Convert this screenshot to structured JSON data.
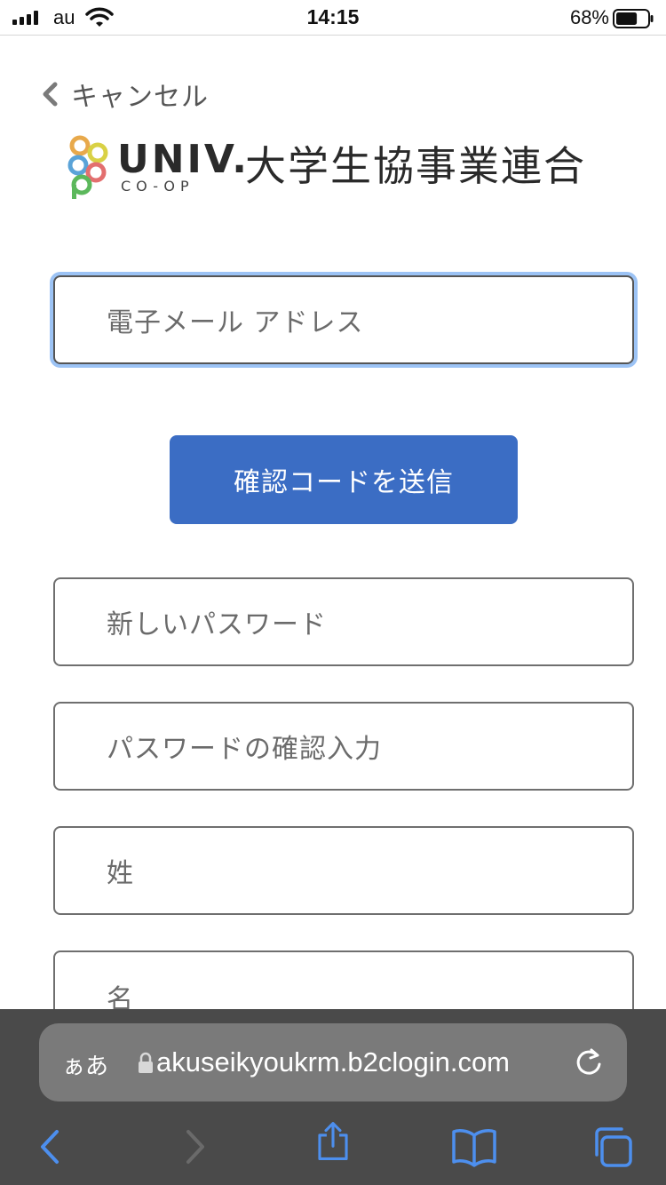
{
  "status_bar": {
    "carrier": "au",
    "time": "14:15",
    "battery_percent": "68%",
    "battery_level": 0.68,
    "icons": [
      "cellular-signal-icon",
      "wifi-icon",
      "battery-icon"
    ]
  },
  "nav": {
    "cancel_label": "キャンセル",
    "back_icon": "chevron-left-icon"
  },
  "logo": {
    "wordmark": "UNIV.",
    "sub_wordmark": "CO-OP",
    "org_name": "大学生協事業連合"
  },
  "form": {
    "email_placeholder": "電子メール アドレス",
    "send_code_label": "確認コードを送信",
    "new_password_placeholder": "新しいパスワード",
    "confirm_password_placeholder": "パスワードの確認入力",
    "last_name_placeholder": "姓",
    "first_name_placeholder": "名"
  },
  "browser": {
    "aa_label": "ぁあ",
    "url": "akuseikyoukrm.b2clogin.com",
    "icons": [
      "lock-icon",
      "reload-icon",
      "back-icon",
      "forward-icon",
      "share-icon",
      "bookmarks-icon",
      "tabs-icon"
    ]
  },
  "colors": {
    "accent_button": "#3b6dc4",
    "focus_ring": "#9cc3f5",
    "browser_chrome": "#4a4a4a",
    "toolbar_icon": "#4d8fee"
  }
}
